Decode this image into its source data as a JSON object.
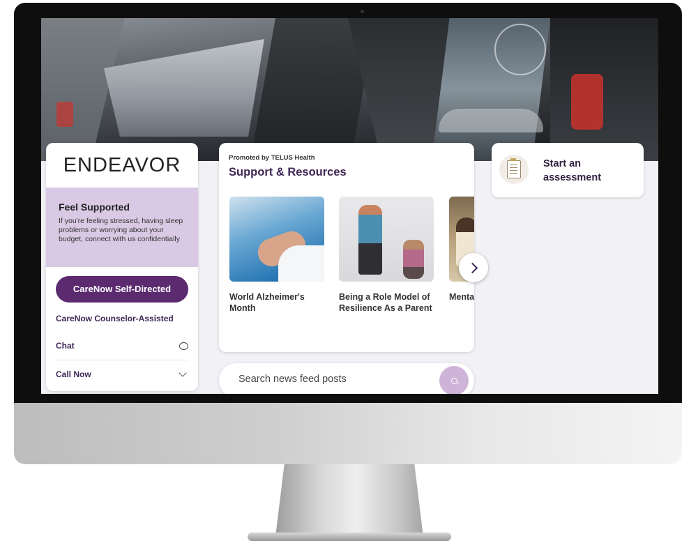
{
  "brand": {
    "name": "ENDEAVOR"
  },
  "promo": {
    "title": "Feel Supported",
    "text": "If you're feeling stressed, having sleep problems or worrying about your budget, connect with us confidentially"
  },
  "actions": {
    "primary_label": "CareNow Self-Directed",
    "counselor_label": "CareNow Counselor-Assisted",
    "chat_label": "Chat",
    "call_label": "Call Now"
  },
  "support": {
    "kicker": "Promoted by TELUS Health",
    "title": "Support & Resources",
    "tiles": [
      {
        "label": "World Alzheimer's Month"
      },
      {
        "label": "Being a Role Model of Resilience As a Parent"
      },
      {
        "label": "Mental Health & Your Child"
      }
    ]
  },
  "assessment": {
    "label": "Start an assessment"
  },
  "search": {
    "placeholder": "Search news feed posts"
  },
  "colors": {
    "accent": "#5b2a6f",
    "promo_bg": "#d9c9e4",
    "search_button": "#cfb4d9",
    "heading": "#3f2755"
  },
  "icons": {
    "chat": "chat-bubble-icon",
    "call": "chevron-down-icon",
    "next": "chevron-right-icon",
    "assessment": "clipboard-icon",
    "search": "search-icon"
  }
}
